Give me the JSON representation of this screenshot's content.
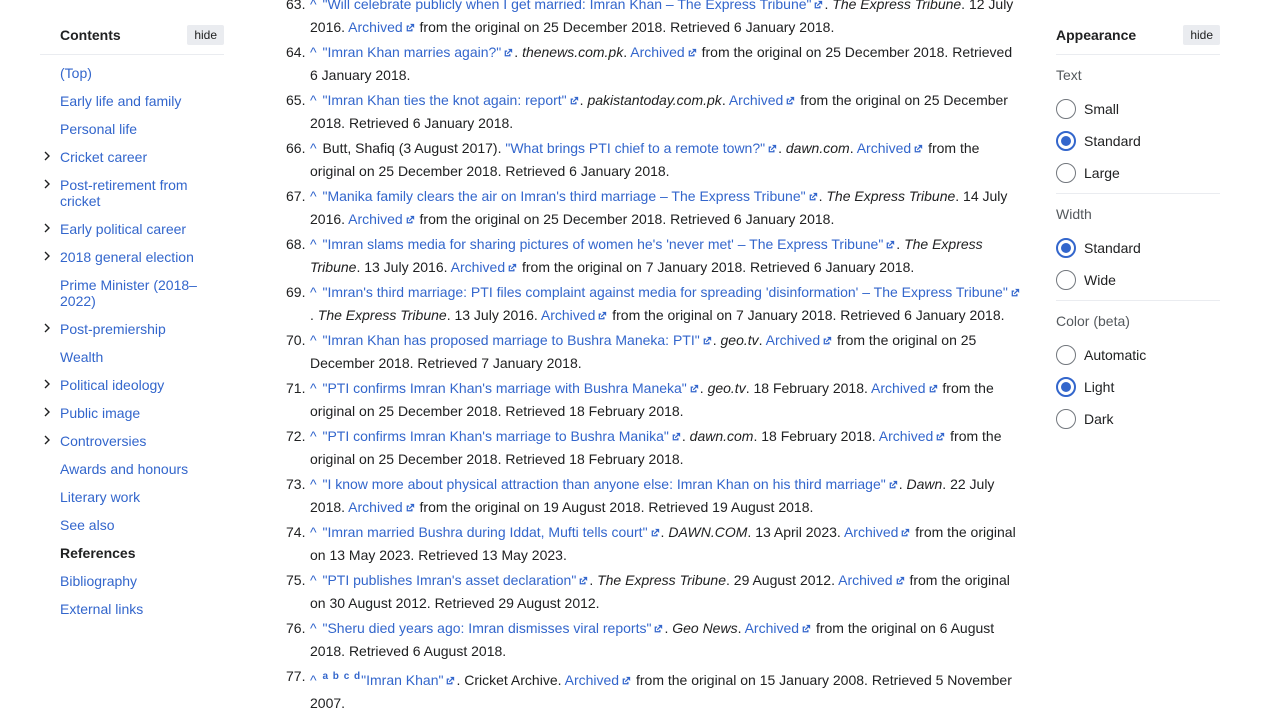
{
  "toc": {
    "title": "Contents",
    "hide_label": "hide",
    "items": [
      {
        "label": "(Top)",
        "expandable": false,
        "active": false
      },
      {
        "label": "Early life and family",
        "expandable": false,
        "active": false
      },
      {
        "label": "Personal life",
        "expandable": false,
        "active": false
      },
      {
        "label": "Cricket career",
        "expandable": true,
        "active": false
      },
      {
        "label": "Post-retirement from cricket",
        "expandable": true,
        "active": false
      },
      {
        "label": "Early political career",
        "expandable": true,
        "active": false
      },
      {
        "label": "2018 general election",
        "expandable": true,
        "active": false
      },
      {
        "label": "Prime Minister (2018–2022)",
        "expandable": false,
        "active": false
      },
      {
        "label": "Post-premiership",
        "expandable": true,
        "active": false
      },
      {
        "label": "Wealth",
        "expandable": false,
        "active": false
      },
      {
        "label": "Political ideology",
        "expandable": true,
        "active": false
      },
      {
        "label": "Public image",
        "expandable": true,
        "active": false
      },
      {
        "label": "Controversies",
        "expandable": true,
        "active": false
      },
      {
        "label": "Awards and honours",
        "expandable": false,
        "active": false
      },
      {
        "label": "Literary work",
        "expandable": false,
        "active": false
      },
      {
        "label": "See also",
        "expandable": false,
        "active": false
      },
      {
        "label": "References",
        "expandable": false,
        "active": true
      },
      {
        "label": "Bibliography",
        "expandable": false,
        "active": false
      },
      {
        "label": "External links",
        "expandable": false,
        "active": false
      }
    ]
  },
  "references": [
    {
      "num": "63.",
      "title": "\"Will celebrate publicly when I get married: Imran Khan – The Express Tribune\"",
      "pub": "The Express Tribune",
      "date": "12 July 2016",
      "archived": "Archived",
      "orig": "from the original on 25 December 2018.",
      "retrieved": "Retrieved 6 January 2018."
    },
    {
      "num": "64.",
      "title": "\"Imran Khan marries again?\"",
      "pub": "thenews.com.pk",
      "date": "",
      "archived": "Archived",
      "orig": "from the original on 25 December 2018.",
      "retrieved": "Retrieved 6 January 2018."
    },
    {
      "num": "65.",
      "title": "\"Imran Khan ties the knot again: report\"",
      "pub": "pakistantoday.com.pk",
      "date": "",
      "archived": "Archived",
      "orig": "from the original on 25 December 2018.",
      "retrieved": "Retrieved 6 January 2018."
    },
    {
      "num": "66.",
      "author": "Butt, Shafiq (3 August 2017).",
      "title": "\"What brings PTI chief to a remote town?\"",
      "pub": "dawn.com",
      "date": "",
      "archived": "Archived",
      "orig": "from the original on 25 December 2018.",
      "retrieved": "Retrieved 6 January 2018."
    },
    {
      "num": "67.",
      "title": "\"Manika family clears the air on Imran's third marriage – The Express Tribune\"",
      "pub": "The Express Tribune",
      "date": "14 July 2016",
      "archived": "Archived",
      "orig": "from the original on 25 December 2018.",
      "retrieved": "Retrieved 6 January 2018."
    },
    {
      "num": "68.",
      "title": "\"Imran slams media for sharing pictures of women he's 'never met' – The Express Tribune\"",
      "pub": "The Express Tribune",
      "date": "13 July 2016",
      "archived": "Archived",
      "orig": "from the original on 7 January 2018.",
      "retrieved": "Retrieved 6 January 2018."
    },
    {
      "num": "69.",
      "title": "\"Imran's third marriage: PTI files complaint against media for spreading 'disinformation' – The Express Tribune\"",
      "pub": "The Express Tribune",
      "date": "13 July 2016",
      "archived": "Archived",
      "orig": "from the original on 7 January 2018.",
      "retrieved": "Retrieved 6 January 2018."
    },
    {
      "num": "70.",
      "title": "\"Imran Khan has proposed marriage to Bushra Maneka: PTI\"",
      "pub": "geo.tv",
      "date": "",
      "archived": "Archived",
      "orig": "from the original on 25 December 2018.",
      "retrieved": "Retrieved 7 January 2018."
    },
    {
      "num": "71.",
      "title": "\"PTI confirms Imran Khan's marriage with Bushra Maneka\"",
      "pub": "geo.tv",
      "date": "18 February 2018",
      "archived": "Archived",
      "orig": "from the original on 25 December 2018.",
      "retrieved": "Retrieved 18 February 2018."
    },
    {
      "num": "72.",
      "title": "\"PTI confirms Imran Khan's marriage to Bushra Manika\"",
      "pub": "dawn.com",
      "date": "18 February 2018",
      "archived": "Archived",
      "orig": "from the original on 25 December 2018.",
      "retrieved": "Retrieved 18 February 2018."
    },
    {
      "num": "73.",
      "title": "\"I know more about physical attraction than anyone else: Imran Khan on his third marriage\"",
      "pub": "Dawn",
      "date": "22 July 2018",
      "archived": "Archived",
      "orig": "from the original on 19 August 2018.",
      "retrieved": "Retrieved 19 August 2018."
    },
    {
      "num": "74.",
      "title": "\"Imran married Bushra during Iddat, Mufti tells court\"",
      "pub": "DAWN.COM",
      "date": "13 April 2023",
      "archived": "Archived",
      "orig": "from the original on 13 May 2023.",
      "retrieved": "Retrieved 13 May 2023."
    },
    {
      "num": "75.",
      "title": "\"PTI publishes Imran's asset declaration\"",
      "pub": "The Express Tribune",
      "date": "29 August 2012",
      "archived": "Archived",
      "orig": "from the original on 30 August 2012.",
      "retrieved": "Retrieved 29 August 2012."
    },
    {
      "num": "76.",
      "title": "\"Sheru died years ago: Imran dismisses viral reports\"",
      "pub": "Geo News",
      "date": "",
      "archived": "Archived",
      "orig": "from the original on 6 August 2018.",
      "retrieved": "Retrieved 6 August 2018."
    },
    {
      "num": "77.",
      "backlinks": "a b c d",
      "title": "\"Imran Khan\"",
      "pub_plain": "Cricket Archive",
      "date": "",
      "archived": "Archived",
      "orig": "from the original on 15 January 2008.",
      "retrieved": "Retrieved 5 November 2007."
    }
  ],
  "appearance": {
    "title": "Appearance",
    "hide_label": "hide",
    "groups": [
      {
        "label": "Text",
        "options": [
          {
            "label": "Small",
            "checked": false
          },
          {
            "label": "Standard",
            "checked": true
          },
          {
            "label": "Large",
            "checked": false
          }
        ]
      },
      {
        "label": "Width",
        "options": [
          {
            "label": "Standard",
            "checked": true
          },
          {
            "label": "Wide",
            "checked": false
          }
        ]
      },
      {
        "label": "Color (beta)",
        "options": [
          {
            "label": "Automatic",
            "checked": false
          },
          {
            "label": "Light",
            "checked": true
          },
          {
            "label": "Dark",
            "checked": false
          }
        ]
      }
    ]
  },
  "colors": {
    "link": "#3366cc",
    "text": "#202122",
    "muted": "#54595d"
  }
}
